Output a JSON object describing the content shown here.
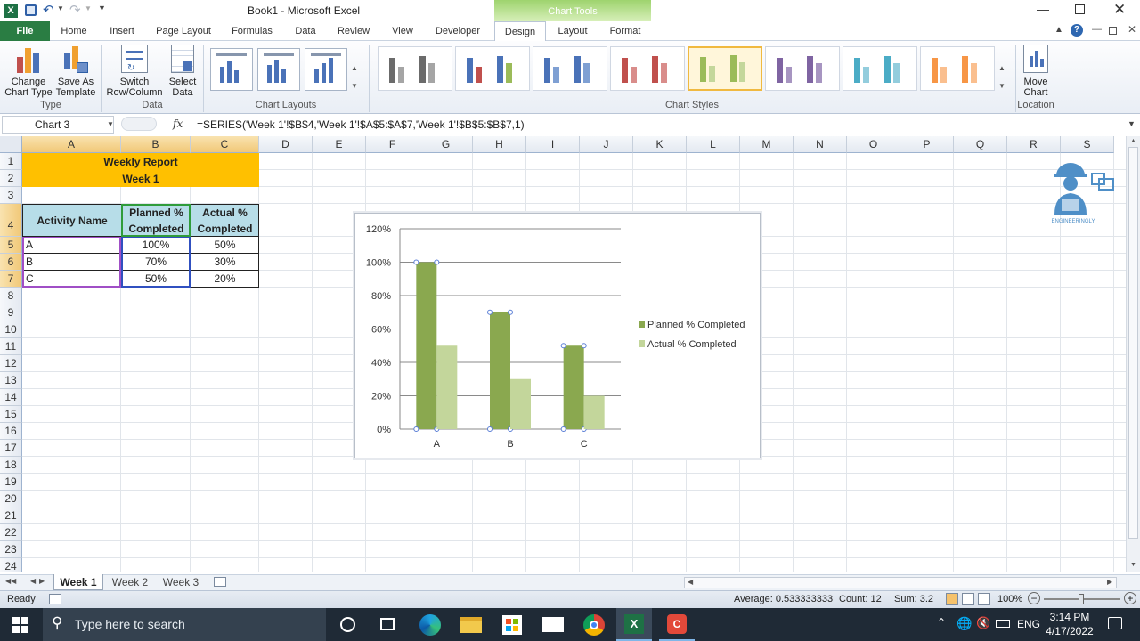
{
  "window": {
    "title": "Book1  -  Microsoft Excel",
    "chart_tools_label": "Chart Tools"
  },
  "tabs": [
    "File",
    "Home",
    "Insert",
    "Page Layout",
    "Formulas",
    "Data",
    "Review",
    "View",
    "Developer",
    "Design",
    "Layout",
    "Format"
  ],
  "ribbon": {
    "change_chart_type": [
      "Change",
      "Chart Type"
    ],
    "save_as_template": [
      "Save As",
      "Template"
    ],
    "switch_row_column": [
      "Switch",
      "Row/Column"
    ],
    "select_data": [
      "Select",
      "Data"
    ],
    "move_chart": [
      "Move",
      "Chart"
    ],
    "group_type": "Type",
    "group_data": "Data",
    "group_chart_layouts": "Chart Layouts",
    "group_chart_styles": "Chart Styles",
    "group_location": "Location",
    "style_colors": [
      [
        "#6b6b6b",
        "#a5a5a5"
      ],
      [
        "#4a72b8",
        "#c0504d",
        "#9bbb59"
      ],
      [
        "#4a72b8",
        "#7fa0d3"
      ],
      [
        "#c0504d",
        "#d98d8b"
      ],
      [
        "#9bbb59",
        "#c4d79b"
      ],
      [
        "#7f64a2",
        "#a795c1"
      ],
      [
        "#4bacc6",
        "#93cddd"
      ],
      [
        "#f79646",
        "#fabf8f"
      ]
    ]
  },
  "formula_bar": {
    "name_box": "Chart 3",
    "fx": "fx",
    "formula": "=SERIES('Week 1'!$B$4,'Week 1'!$A$5:$A$7,'Week 1'!$B$5:$B$7,1)"
  },
  "columns": [
    "A",
    "B",
    "C",
    "D",
    "E",
    "F",
    "G",
    "H",
    "I",
    "J",
    "K",
    "L",
    "M",
    "N",
    "O",
    "P",
    "Q",
    "R",
    "S"
  ],
  "rows": [
    "1",
    "2",
    "3",
    "4",
    "5",
    "6",
    "7",
    "8",
    "9",
    "10",
    "11",
    "12",
    "13",
    "14",
    "15",
    "16",
    "17",
    "18",
    "19",
    "20",
    "21",
    "22",
    "23",
    "24"
  ],
  "sheet": {
    "report_title": "Weekly Report",
    "report_week": "Week 1",
    "headers": {
      "activity": "Activity Name",
      "planned": [
        "Planned %",
        "Completed"
      ],
      "actual": [
        "Actual %",
        "Completed"
      ]
    },
    "rows": [
      {
        "name": "A",
        "planned": "100%",
        "actual": "50%"
      },
      {
        "name": "B",
        "planned": "70%",
        "actual": "30%"
      },
      {
        "name": "C",
        "planned": "50%",
        "actual": "20%"
      }
    ],
    "header_fill": "#ffc000",
    "table_header_fill": "#b7dde8",
    "logo_text": "ENGINEERINGLY"
  },
  "chart_data": {
    "type": "bar",
    "categories": [
      "A",
      "B",
      "C"
    ],
    "series": [
      {
        "name": "Planned % Completed",
        "values": [
          100,
          70,
          50
        ],
        "color": "#8aa84f"
      },
      {
        "name": "Actual % Completed",
        "values": [
          50,
          30,
          20
        ],
        "color": "#c3d69b"
      }
    ],
    "y_ticks": [
      "0%",
      "20%",
      "40%",
      "60%",
      "80%",
      "100%",
      "120%"
    ],
    "ylim": [
      0,
      120
    ],
    "grid": true,
    "legend": "right"
  },
  "sheet_tabs": [
    "Week 1",
    "Week 2",
    "Week 3"
  ],
  "status": {
    "ready": "Ready",
    "average": "Average: 0.533333333",
    "count": "Count: 12",
    "sum": "Sum: 3.2",
    "zoom": "100%"
  },
  "taskbar": {
    "search_placeholder": "Type here to search",
    "lang": "ENG",
    "time": "3:14 PM",
    "date": "4/17/2022"
  }
}
